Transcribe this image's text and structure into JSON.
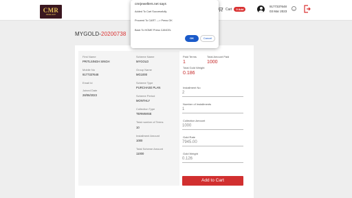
{
  "header": {
    "logo_text": "CMR",
    "logo_subtext": "JEWELLERY",
    "cart_label": "Cart",
    "cart_badge": "0 Add",
    "user_phone": "9177337648",
    "user_date": "03 Mar 2023"
  },
  "page": {
    "title_prefix": "MYGOLD-",
    "title_id": "20200738"
  },
  "customer": {
    "first_name_label": "First Name",
    "first_name": "PRITLSINGH SINGH",
    "mobile_label": "Mobile No",
    "mobile": "9177337648",
    "email_label": "Email Id",
    "email": "",
    "joined_label": "Joined Date",
    "joined": "28/06/2023"
  },
  "scheme": {
    "name_label": "Scheme Name",
    "name": "MYGOLD",
    "group_label": "Group Name",
    "group": "MG1000",
    "type_label": "Scheme Type",
    "type": "PURCHASE PLAN",
    "period_label": "Scheme Period",
    "period": "MONTHLY",
    "collection_label": "Collection Type",
    "collection": "TERMWISE",
    "terms_label": "Total number of Terms",
    "terms": "10",
    "installment_label": "Installment Amount",
    "installment": "1000",
    "total_label": "Total Scheme Amount",
    "total": "11000"
  },
  "summary": {
    "paid_terms_label": "Paid Terms",
    "paid_terms": "1",
    "total_paid_label": "Total Amount Paid",
    "total_paid": "1000",
    "gold_weight_label": "Total Gold Weight",
    "gold_weight": "0.186",
    "installment_no_label": "Installment No",
    "installment_no": "2",
    "num_installments_label": "Number of Installments",
    "num_installments": "1",
    "collection_amount_label": "Collection Amount",
    "collection_amount": "1000",
    "gold_rate_label": "Gold Rate",
    "gold_rate": "7945.00",
    "gold_wt_label": "Gold Weight",
    "gold_wt": "0.126",
    "add_to_cart": "Add to Cart"
  },
  "dialog": {
    "title": "cmrjewellers.net says",
    "line1": "Added To Cart Successfully",
    "line2": "Proceed To CART ---> Press OK",
    "line3": "Back To HOME  Press CANCEL",
    "ok": "OK",
    "cancel": "Cancel"
  }
}
